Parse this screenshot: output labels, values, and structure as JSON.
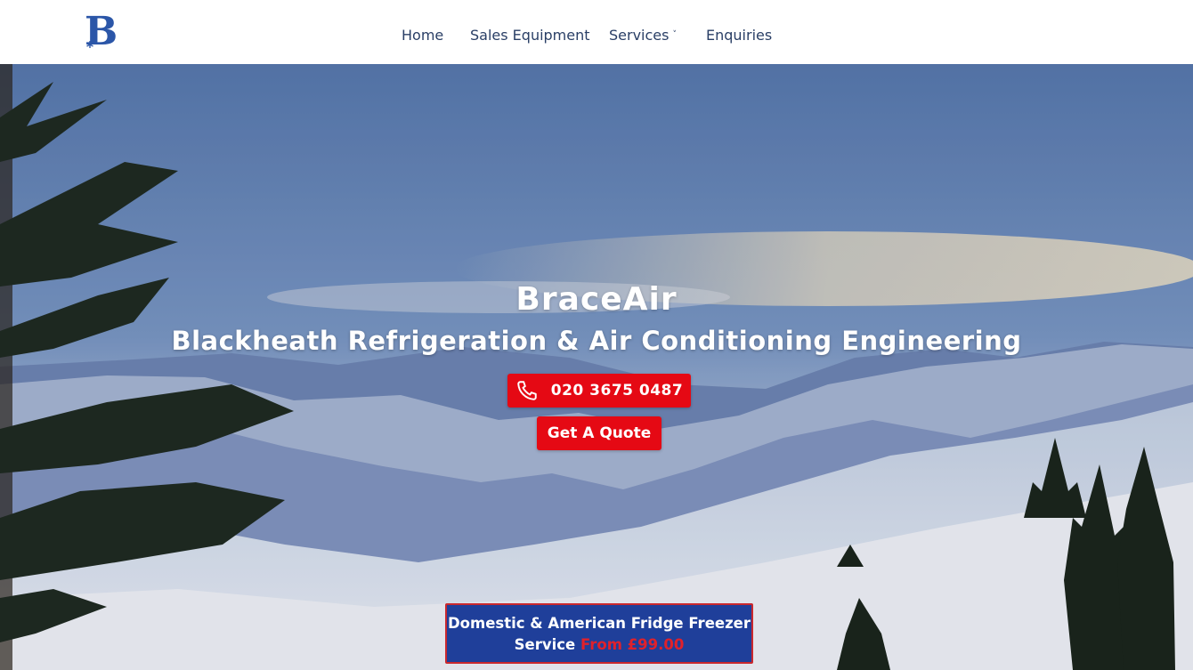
{
  "header": {
    "logo_letter": "B",
    "nav": [
      {
        "label": "Home"
      },
      {
        "label": "Sales Equipment"
      },
      {
        "label": "Services",
        "caret": "˅"
      },
      {
        "label": "Enquiries"
      }
    ]
  },
  "hero": {
    "title": "BraceAir",
    "subtitle": "Blackheath Refrigeration & Air Conditioning Engineering",
    "phone_label": "020 3675 0487",
    "quote_label": "Get A Quote",
    "promo_line1": "Domestic & American Fridge Freezer",
    "promo_line2": "Service",
    "promo_price": "From £99.00"
  },
  "colors": {
    "brand_blue": "#2b56a8",
    "cta_red": "#e50914",
    "promo_blue": "#1f3f9a",
    "nav_text": "#2a3f66"
  },
  "icons": {
    "logo": "braceair-b-snowflake-logo",
    "phone": "phone-icon",
    "caret": "chevron-down-icon"
  }
}
